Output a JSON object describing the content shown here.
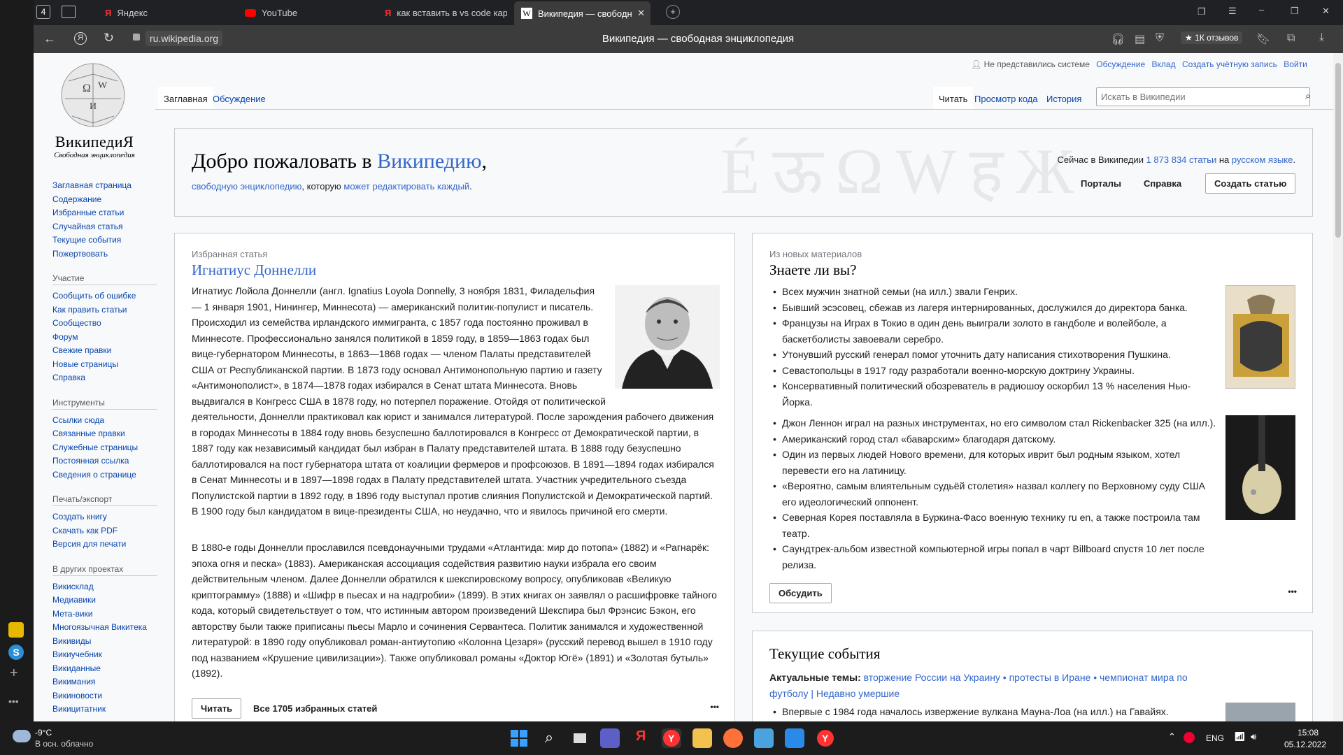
{
  "browser": {
    "tab_count": "4",
    "tabs": [
      "Яндекс",
      "YouTube",
      "как вставить в vs code кар",
      "Википедия — свободн"
    ],
    "url": "ru.wikipedia.org",
    "page_title": "Википедия — свободная энциклопедия",
    "reviews": "★ 1К отзывов"
  },
  "wiki": {
    "logo_title": "ВикипедиЯ",
    "logo_subtitle": "Свободная энциклопедия",
    "personal": [
      "Не представились системе",
      "Обсуждение",
      "Вклад",
      "Создать учётную запись",
      "Войти"
    ],
    "tabs_left": [
      "Заглавная",
      "Обсуждение"
    ],
    "tabs_right": [
      "Читать",
      "Просмотр кода",
      "История"
    ],
    "search_placeholder": "Искать в Википедии",
    "nav_main": [
      "Заглавная страница",
      "Содержание",
      "Избранные статьи",
      "Случайная статья",
      "Текущие события",
      "Пожертвовать"
    ],
    "nav_part_h": "Участие",
    "nav_part": [
      "Сообщить об ошибке",
      "Как править статьи",
      "Сообщество",
      "Форум",
      "Свежие правки",
      "Новые страницы",
      "Справка"
    ],
    "nav_tools_h": "Инструменты",
    "nav_tools": [
      "Ссылки сюда",
      "Связанные правки",
      "Служебные страницы",
      "Постоянная ссылка",
      "Сведения о странице"
    ],
    "nav_print_h": "Печать/экспорт",
    "nav_print": [
      "Создать книгу",
      "Скачать как PDF",
      "Версия для печати"
    ],
    "nav_other_h": "В других проектах",
    "nav_other": [
      "Викисклад",
      "Медиавики",
      "Мета-вики",
      "Многоязычная Викитека",
      "Викивиды",
      "Викиучебник",
      "Викиданные",
      "Викимания",
      "Викиновости",
      "Викицитатник"
    ],
    "welcome_a": "Добро пожаловать в ",
    "welcome_b": "Википедию",
    "welcome_c": ",",
    "welcome_sub_a": "свободную энциклопедию",
    "welcome_sub_b": ", которую ",
    "welcome_sub_c": "может редактировать каждый",
    "welcome_sub_d": ".",
    "stats_a": "Сейчас в Википедии ",
    "stats_b": "1 873 834 статьи",
    "stats_c": " на ",
    "stats_d": "русском языке",
    "stats_e": ".",
    "portals": "Порталы",
    "help": "Справка",
    "create": "Создать статью",
    "featured_hdr": "Избранная статья",
    "featured_title": "Игнатиус Доннелли",
    "featured_p1": "Игнатиус Лойола Доннелли (англ. Ignatius Loyola Donnelly, 3 ноября 1831, Филадельфия — 1 января 1901, Нинингер, Миннесота) — американский политик-популист и писатель. Происходил из семейства ирландского иммигранта, с 1857 года постоянно проживал в Миннесоте. Профессионально занялся политикой в 1859 году, в 1859—1863 годах был вице-губернатором Миннесоты, в 1863—1868 годах — членом Палаты представителей США от Республиканской партии. В 1873 году основал Антимонопольную партию и газету «Антимонополист», в 1874—1878 годах избирался в Сенат штата Миннесота. Вновь выдвигался в Конгресс США в 1878 году, но потерпел поражение. Отойдя от политической деятельности, Доннелли практиковал как юрист и занимался литературой. После зарождения рабочего движения в городах Миннесоты в 1884 году вновь безуспешно баллотировался в Конгресс от Демократической партии, в 1887 году как независимый кандидат был избран в Палату представителей штата. В 1888 году безуспешно баллотировался на пост губернатора штата от коалиции фермеров и профсоюзов. В 1891—1894 годах избирался в Сенат Миннесоты и в 1897—1898 годах в Палату представителей штата. Участник учредительного съезда Популистской партии в 1892 году, в 1896 году выступал против слияния Популистской и Демократической партий. В 1900 году был кандидатом в вице-президенты США, но неудачно, что и явилось причиной его смерти.",
    "featured_p2": "В 1880-е годы Доннелли прославился псевдонаучными трудами «Атлантида: мир до потопа» (1882) и «Рагнарёк: эпоха огня и песка» (1883). Американская ассоциация содействия развитию науки избрала его своим действительным членом. Далее Доннелли обратился к шекспировскому вопросу, опубликовав «Великую криптограмму» (1888) и «Шифр в пьесах и на надгробии» (1899). В этих книгах он заявлял о расшифровке тайного кода, который свидетельствует о том, что истинным автором произведений Шекспира был Фрэнсис Бэкон, его авторству были также приписаны пьесы Марло и сочинения Сервантеса. Политик занимался и художественной литературой: в 1890 году опубликовал роман-антиутопию «Колонна Цезаря» (русский перевод вышел в 1910 году под названием «Крушение цивилизации»). Также опубликовал романы «Доктор Югё» (1891) и «Золотая бутыль» (1892).",
    "read_btn": "Читать",
    "all_featured": "Все 1705 избранных статей",
    "dyk_hdr": "Из новых материалов",
    "dyk_title": "Знаете ли вы?",
    "dyk_items": [
      "Всех мужчин знатной семьи (на илл.) звали Генрих.",
      "Бывший эсэсовец, сбежав из лагеря интернированных, дослужился до директора банка.",
      "Французы на Играх в Токио в один день выиграли золото в гандболе и волейболе, а баскетболисты завоевали серебро.",
      "Утонувший русский генерал помог уточнить дату написания стихотворения Пушкина.",
      "Севастопольцы в 1917 году разработали военно-морскую доктрину Украины.",
      "Консервативный политический обозреватель в радиошоу оскорбил 13 % населения Нью-Йорка.",
      "Джон Леннон играл на разных инструментах, но его символом стал Rickenbacker 325 (на илл.).",
      "Американский город стал «баварским» благодаря датскому.",
      "Один из первых людей Нового времени, для которых иврит был родным языком, хотел перевести его на латиницу.",
      "«Вероятно, самым влиятельным судьёй столетия» назвал коллегу по Верховному суду США его идеологический оппонент.",
      "Северная Корея поставляла в Буркина-Фасо военную технику ru en, а также построила там театр.",
      "Саундтрек-альбом известной компьютерной игры попал в чарт Billboard спустя 10 лет после релиза."
    ],
    "discuss_btn": "Обсудить",
    "more": "•••",
    "current_title": "Текущие события",
    "current_topics_lbl": "Актуальные темы: ",
    "current_topics": "вторжение России на Украину • протесты в Иране • чемпионат мира по футболу | Недавно умершие",
    "current_item": "Впервые с 1984 года началось извержение вулкана Мауна-Лоа (на илл.) на Гавайях."
  },
  "taskbar": {
    "weather_temp": "-9°C",
    "weather_desc": "В осн. облачно",
    "lang": "ENG",
    "time": "15:08",
    "date": "05.12.2022"
  }
}
